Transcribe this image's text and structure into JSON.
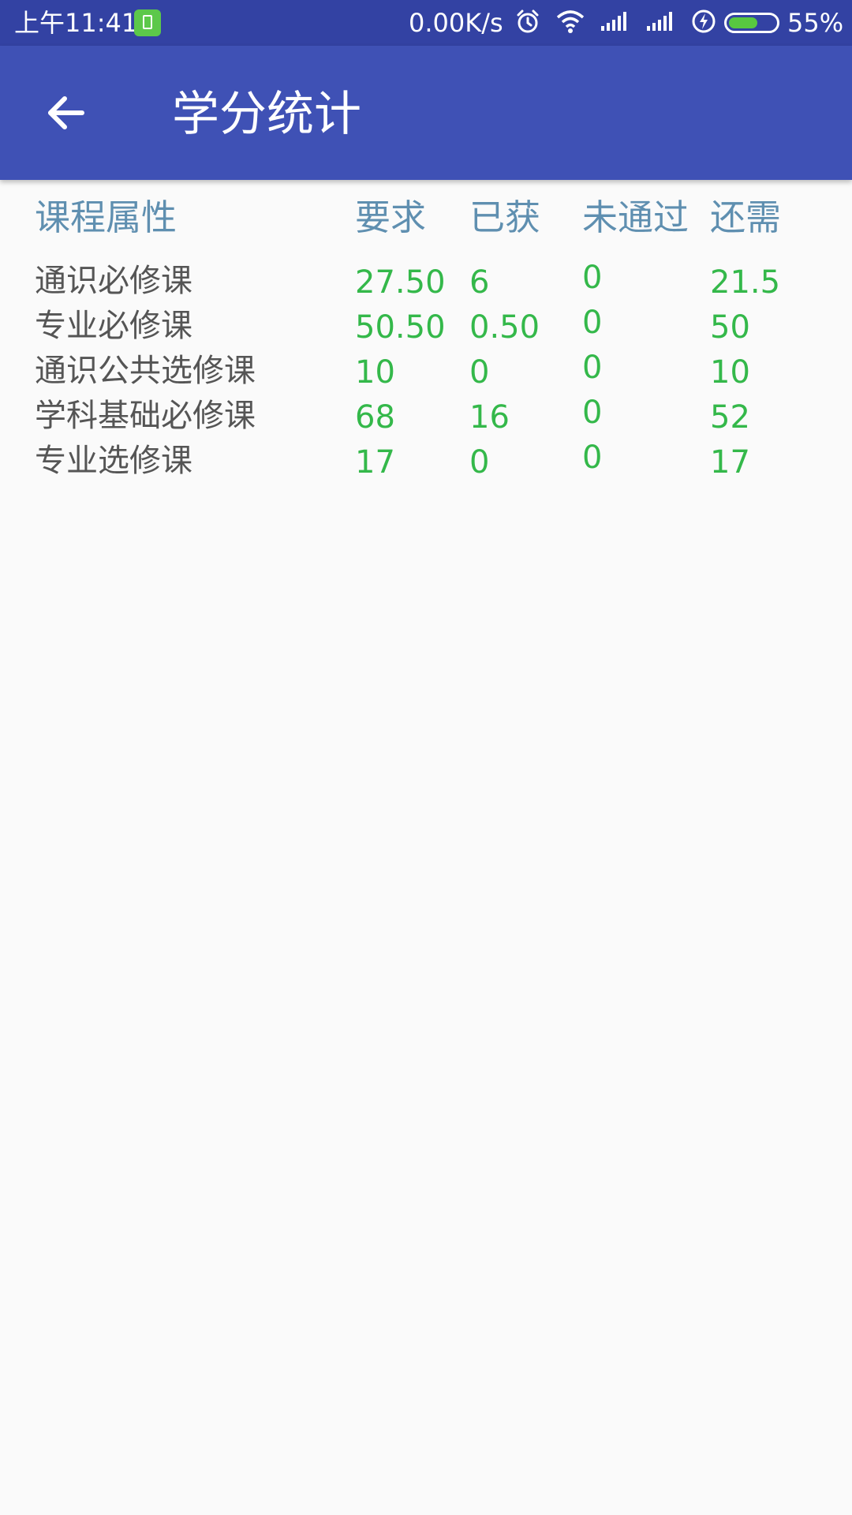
{
  "status_bar": {
    "time": "上午11:41",
    "net_speed": "0.00K/s",
    "battery_percent": "55%",
    "battery_level": 0.55,
    "icons": [
      "battery-saver-icon",
      "alarm-icon",
      "wifi-icon",
      "signal-icon",
      "signal-icon",
      "charging-icon",
      "battery-icon"
    ]
  },
  "app_bar": {
    "title": "学分统计",
    "back_icon": "arrow-back-icon",
    "color": "#3f51b5"
  },
  "table": {
    "headers": {
      "name": "课程属性",
      "required": "要求",
      "earned": "已获",
      "failed": "未通过",
      "remaining": "还需"
    },
    "rows": [
      {
        "name": "通识必修课",
        "required": "27.50",
        "earned": "6",
        "failed": "0",
        "remaining": "21.5"
      },
      {
        "name": "专业必修课",
        "required": "50.50",
        "earned": "0.50",
        "failed": "0",
        "remaining": "50"
      },
      {
        "name": "通识公共选修课",
        "required": "10",
        "earned": "0",
        "failed": "0",
        "remaining": "10"
      },
      {
        "name": "学科基础必修课",
        "required": "68",
        "earned": "16",
        "failed": "0",
        "remaining": "52"
      },
      {
        "name": "专业选修课",
        "required": "17",
        "earned": "0",
        "failed": "0",
        "remaining": "17"
      }
    ],
    "colors": {
      "header": "#5f8fb0",
      "name": "#555555",
      "value": "#34b84a"
    }
  }
}
